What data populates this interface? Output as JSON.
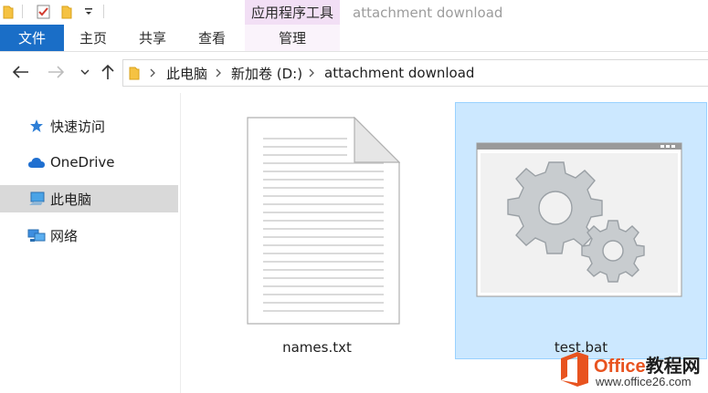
{
  "quick_access": {
    "tool_context": "应用程序工具",
    "window_title": "attachment download"
  },
  "ribbon": {
    "tabs": [
      {
        "label": "文件"
      },
      {
        "label": "主页"
      },
      {
        "label": "共享"
      },
      {
        "label": "查看"
      },
      {
        "label": "管理"
      }
    ]
  },
  "address_bar": {
    "crumbs": [
      {
        "label": "此电脑"
      },
      {
        "label": "新加卷 (D:)"
      },
      {
        "label": "attachment download"
      }
    ]
  },
  "sidebar": {
    "items": [
      {
        "label": "快速访问",
        "icon": "star-icon"
      },
      {
        "label": "OneDrive",
        "icon": "cloud-icon"
      },
      {
        "label": "此电脑",
        "icon": "computer-icon",
        "selected": true
      },
      {
        "label": "网络",
        "icon": "network-icon"
      }
    ]
  },
  "files": [
    {
      "name": "names.txt",
      "icon": "text-document-icon",
      "selected": false
    },
    {
      "name": "test.bat",
      "icon": "batch-file-icon",
      "selected": true
    }
  ],
  "watermark": {
    "brand_office": "Office",
    "brand_suffix": "教程网",
    "url": "www.office26.com"
  },
  "colors": {
    "accent": "#1a6ec7",
    "selection": "#cce8ff",
    "tool_context": "#f2dff5",
    "watermark_orange": "#e8531f"
  }
}
